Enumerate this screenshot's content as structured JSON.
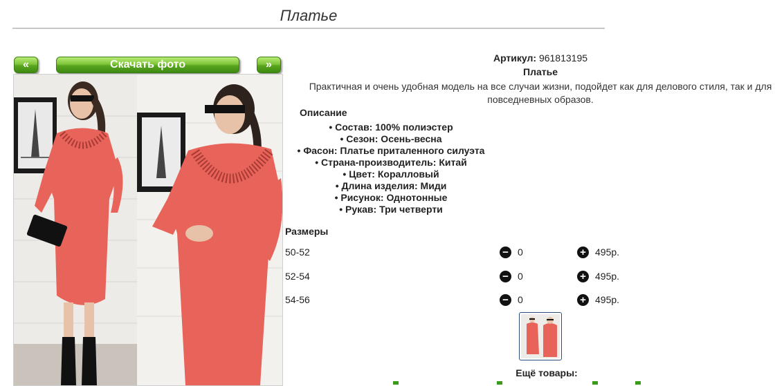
{
  "page": {
    "title": "Платье"
  },
  "gallery": {
    "prev_label": "«",
    "download_label": "Скачать фото",
    "next_label": "»"
  },
  "product": {
    "article_label": "Артикул:",
    "article_value": "961813195",
    "name": "Платье",
    "description": "Практичная и очень удобная модель на все случаи жизни, подойдет как для делового стиля, так и для повседневных образов.",
    "description_heading": "Описание",
    "attributes": [
      "Состав: 100% полиэстер",
      "Сезон: Осень-весна",
      "Фасон: Платье приталенного силуэта",
      "Страна-производитель: Китай",
      "Цвет: Коралловый",
      "Длина изделия: Миди",
      "Рисунок: Однотонные",
      "Рукав: Три четверти"
    ],
    "accent_color": "#e8635a"
  },
  "sizes": {
    "heading": "Размеры",
    "rows": [
      {
        "size": "50-52",
        "qty": "0",
        "price": "495р."
      },
      {
        "size": "52-54",
        "qty": "0",
        "price": "495р."
      },
      {
        "size": "54-56",
        "qty": "0",
        "price": "495р."
      }
    ],
    "minus_icon": "minus-circle-icon",
    "plus_icon": "plus-circle-icon"
  },
  "more": {
    "heading": "Ещё товары:"
  },
  "colors": {
    "button_green": "#5aa51f",
    "more_green": "#3a9a1a"
  }
}
